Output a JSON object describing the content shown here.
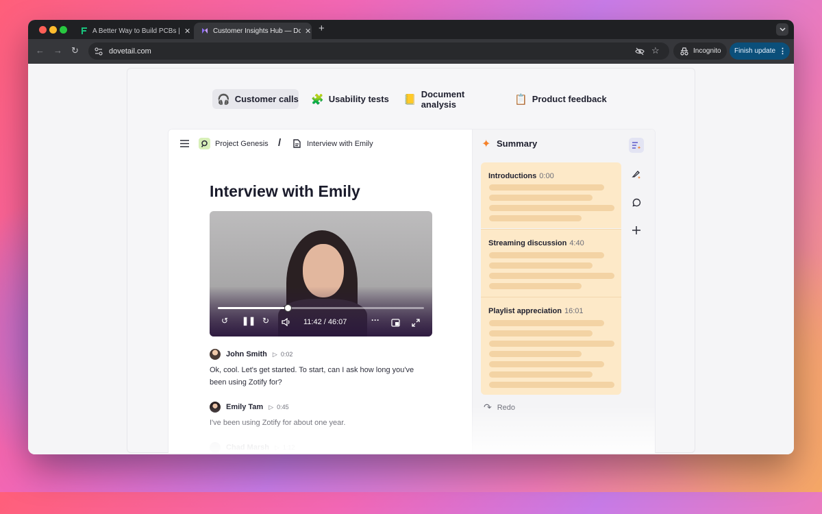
{
  "browser": {
    "tabs": [
      {
        "title": "A Better Way to Build PCBs | F",
        "close": "✕"
      },
      {
        "title": "Customer Insights Hub — Dov",
        "close": "✕"
      }
    ],
    "new_tab": "+",
    "url": "dovetail.com",
    "incognito_label": "Incognito",
    "finish_update_label": "Finish update",
    "accent": "#0b5cd6"
  },
  "categories": [
    {
      "label": "Customer calls",
      "icon": "headset-icon",
      "emoji": "🎧"
    },
    {
      "label": "Usability tests",
      "icon": "shapes-icon",
      "emoji": "🧩"
    },
    {
      "label": "Document analysis",
      "icon": "document-icon",
      "emoji": "📒"
    },
    {
      "label": "Product feedback",
      "icon": "feedback-icon",
      "emoji": "📋"
    }
  ],
  "breadcrumb": {
    "project": "Project Genesis",
    "separator": "/",
    "page": "Interview with Emily"
  },
  "main": {
    "title": "Interview with Emily",
    "video": {
      "current_time": "11:42",
      "total_time": "46:07",
      "progress": 0.34
    },
    "transcript": [
      {
        "speaker": "John Smith",
        "timestamp": "0:02",
        "text": "Ok, cool. Let's get started. To start, can I ask how long you've been using Zotify for?"
      },
      {
        "speaker": "Emily Tam",
        "timestamp": "0:45",
        "text": "I've been using Zotify for about one year."
      },
      {
        "speaker": "Chad Marsh",
        "timestamp": "1:12",
        "text": ""
      }
    ]
  },
  "summary": {
    "title": "Summary",
    "sections": [
      {
        "heading": "Introductions",
        "time": "0:00"
      },
      {
        "heading": "Streaming discussion",
        "time": "4:40"
      },
      {
        "heading": "Playlist appreciation",
        "time": "16:01"
      }
    ],
    "redo_label": "Redo",
    "highlight_color": "#fde9c8"
  }
}
